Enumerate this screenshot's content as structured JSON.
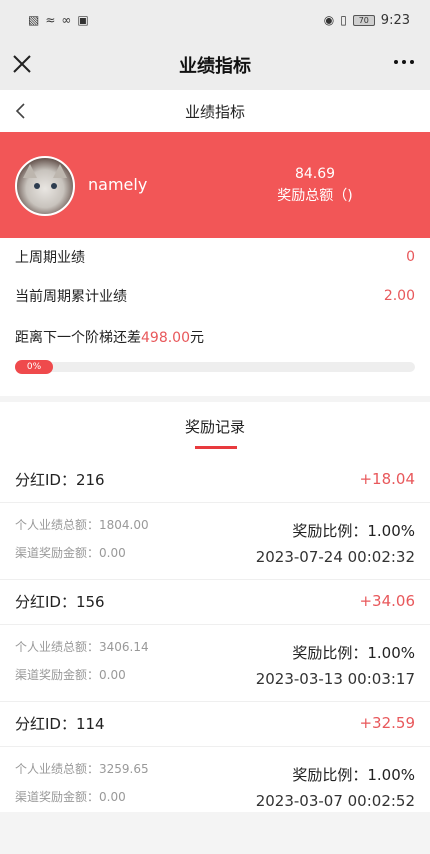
{
  "status_bar": {
    "time": "9:23",
    "battery": "70",
    "left_icons": [
      "sim-icon",
      "wifi-icon",
      "signal-icon",
      "app-icon"
    ],
    "right_icons": [
      "eye-icon",
      "vibrate-icon"
    ]
  },
  "app_header": {
    "title": "业绩指标"
  },
  "page_header": {
    "title": "业绩指标"
  },
  "user": {
    "name": "namely",
    "reward_total": "84.69",
    "reward_label": "奖励总额（)"
  },
  "performance": {
    "last_period_label": "上周期业绩",
    "last_period_value": "0",
    "current_period_label": "当前周期累计业绩",
    "current_period_value": "2.00",
    "next_tier_prefix": "距离下一个阶梯还差",
    "next_tier_amount": "498.00",
    "next_tier_suffix": "元",
    "progress_text": "0%",
    "progress_value": 0
  },
  "rewards": {
    "title": "奖励记录",
    "records": [
      {
        "id_label": "分红ID：216",
        "amount": "+18.04",
        "total_perf": "个人业绩总额：1804.00",
        "channel_reward": "渠道奖励金额：0.00",
        "ratio": "奖励比例：1.00%",
        "time": "2023-07-24 00:02:32"
      },
      {
        "id_label": "分红ID：156",
        "amount": "+34.06",
        "total_perf": "个人业绩总额：3406.14",
        "channel_reward": "渠道奖励金额：0.00",
        "ratio": "奖励比例：1.00%",
        "time": "2023-03-13 00:03:17"
      },
      {
        "id_label": "分红ID：114",
        "amount": "+32.59",
        "total_perf": "个人业绩总额：3259.65",
        "channel_reward": "渠道奖励金额：0.00",
        "ratio": "奖励比例：1.00%",
        "time": "2023-03-07 00:02:52"
      }
    ]
  },
  "colors": {
    "accent_red": "#f25657",
    "value_red": "#e8585b"
  }
}
